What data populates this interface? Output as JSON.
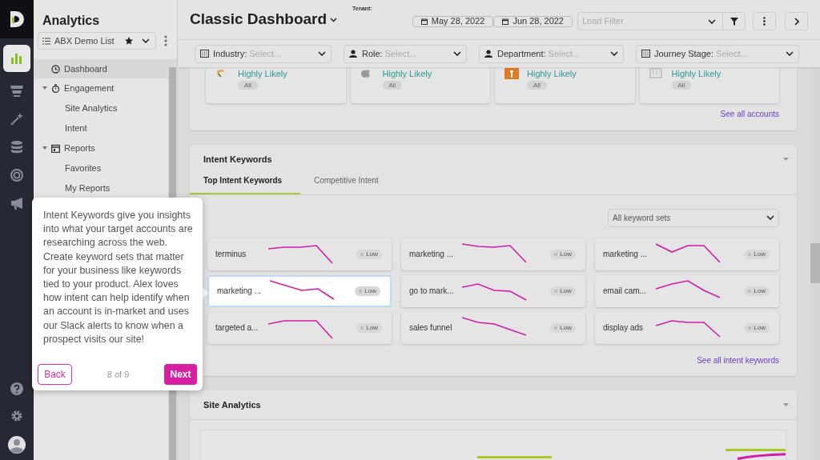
{
  "rail": {
    "items": [
      {
        "selected": true
      },
      {
        "selected": false
      },
      {
        "selected": false
      },
      {
        "selected": false
      },
      {
        "selected": false
      },
      {
        "selected": false
      }
    ]
  },
  "sidebar": {
    "title": "Analytics",
    "list_selector": {
      "value": "ABX Demo List",
      "starred": true
    },
    "items": [
      {
        "label": "Dashboard",
        "selected": true
      },
      {
        "label": "Engagement",
        "selected": false,
        "expanded": true,
        "children": [
          {
            "label": "Site Analytics",
            "selected": false
          },
          {
            "label": "Intent",
            "selected": false
          }
        ]
      },
      {
        "label": "Reports",
        "selected": false,
        "expanded": true,
        "children": [
          {
            "label": "Favorites",
            "selected": false
          },
          {
            "label": "My Reports",
            "selected": false
          }
        ]
      }
    ]
  },
  "header": {
    "title": "Classic Dashboard",
    "tenant_label": "Tenant:",
    "date_from": "May 28, 2022",
    "date_to": "Jun 28, 2022",
    "load_filter": {
      "placeholder": "Load Filter"
    }
  },
  "filters": [
    {
      "label": "Industry:",
      "placeholder": "Select..."
    },
    {
      "label": "Role:",
      "placeholder": "Select..."
    },
    {
      "label": "Department:",
      "placeholder": "Select..."
    },
    {
      "label": "Journey Stage:",
      "placeholder": "Select..."
    }
  ],
  "accounts": {
    "cards": [
      {
        "likelihood": "Highly Likely",
        "tag": "All"
      },
      {
        "likelihood": "Highly Likely",
        "tag": "All"
      },
      {
        "likelihood": "Highly Likely",
        "tag": "All"
      },
      {
        "likelihood": "Highly Likely",
        "tag": "All"
      }
    ],
    "link": "See all accounts"
  },
  "intent": {
    "title": "Intent Keywords",
    "tabs": [
      {
        "label": "Top Intent Keywords",
        "selected": true
      },
      {
        "label": "Competitive Intent",
        "selected": false
      }
    ],
    "keyword_set": "All keyword sets",
    "keywords": [
      {
        "label": "terminus",
        "level_text": "Low",
        "highlighted": false
      },
      {
        "label": "marketing ...",
        "level_text": "Low",
        "highlighted": false
      },
      {
        "label": "marketing ...",
        "level_text": "Low",
        "highlighted": false
      },
      {
        "label": "marketing ...",
        "level_text": "Low",
        "highlighted": true
      },
      {
        "label": "go to mark...",
        "level_text": "Low",
        "highlighted": false
      },
      {
        "label": "email cam...",
        "level_text": "Low",
        "highlighted": false
      },
      {
        "label": "targeted a...",
        "level_text": "Low",
        "highlighted": false
      },
      {
        "label": "sales funnel",
        "level_text": "Low",
        "highlighted": false
      },
      {
        "label": "display ads",
        "level_text": "Low",
        "highlighted": false
      }
    ],
    "link": "See all intent keywords"
  },
  "site_analytics": {
    "title": "Site Analytics"
  },
  "tour": {
    "text": "Intent Keywords give you insights into what your target accounts are researching across the web. Create keyword sets that matter for your business like keywords tied to your product. Alex loves how intent can help identify when an account is in-market and uses our Slack alerts to know when a prospect visits our site!",
    "back": "Back",
    "progress": "8 of 9",
    "next": "Next"
  }
}
